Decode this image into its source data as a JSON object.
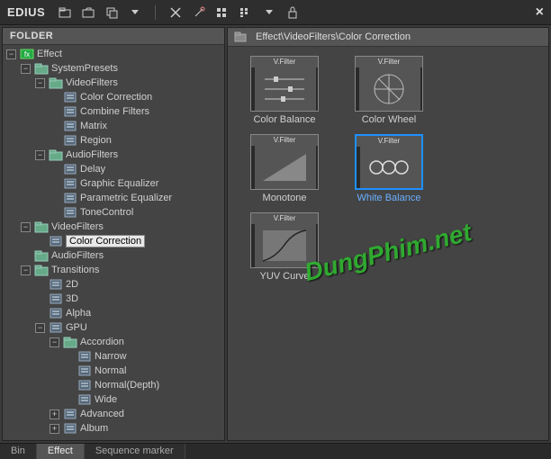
{
  "app": {
    "name": "EDIUS"
  },
  "titlebar_icons": [
    "folder",
    "tab",
    "copy",
    "dropdown",
    "cut",
    "wand",
    "list1",
    "list2",
    "lock"
  ],
  "left": {
    "header": "FOLDER",
    "tree": [
      {
        "d": 0,
        "exp": "-",
        "ico": "fx",
        "label": "Effect",
        "sel": false
      },
      {
        "d": 1,
        "exp": "-",
        "ico": "folder",
        "label": "SystemPresets"
      },
      {
        "d": 2,
        "exp": "-",
        "ico": "folder",
        "label": "VideoFilters"
      },
      {
        "d": 3,
        "exp": "",
        "ico": "fx-item",
        "label": "Color Correction"
      },
      {
        "d": 3,
        "exp": "",
        "ico": "fx-item",
        "label": "Combine Filters"
      },
      {
        "d": 3,
        "exp": "",
        "ico": "fx-item",
        "label": "Matrix"
      },
      {
        "d": 3,
        "exp": "",
        "ico": "fx-item",
        "label": "Region"
      },
      {
        "d": 2,
        "exp": "-",
        "ico": "folder",
        "label": "AudioFilters"
      },
      {
        "d": 3,
        "exp": "",
        "ico": "fx-item",
        "label": "Delay"
      },
      {
        "d": 3,
        "exp": "",
        "ico": "fx-item",
        "label": "Graphic Equalizer"
      },
      {
        "d": 3,
        "exp": "",
        "ico": "fx-item",
        "label": "Parametric Equalizer"
      },
      {
        "d": 3,
        "exp": "",
        "ico": "fx-item",
        "label": "ToneControl"
      },
      {
        "d": 1,
        "exp": "-",
        "ico": "folder",
        "label": "VideoFilters"
      },
      {
        "d": 2,
        "exp": "",
        "ico": "fx-item",
        "label": "Color Correction",
        "sel": true
      },
      {
        "d": 1,
        "exp": "",
        "ico": "folder",
        "label": "AudioFilters"
      },
      {
        "d": 1,
        "exp": "-",
        "ico": "folder",
        "label": "Transitions"
      },
      {
        "d": 2,
        "exp": "",
        "ico": "fx-item",
        "label": "2D"
      },
      {
        "d": 2,
        "exp": "",
        "ico": "fx-item",
        "label": "3D"
      },
      {
        "d": 2,
        "exp": "",
        "ico": "fx-item",
        "label": "Alpha"
      },
      {
        "d": 2,
        "exp": "-",
        "ico": "fx-item",
        "label": "GPU"
      },
      {
        "d": 3,
        "exp": "-",
        "ico": "folder",
        "label": "Accordion"
      },
      {
        "d": 4,
        "exp": "",
        "ico": "fx-item",
        "label": "Narrow"
      },
      {
        "d": 4,
        "exp": "",
        "ico": "fx-item",
        "label": "Normal"
      },
      {
        "d": 4,
        "exp": "",
        "ico": "fx-item",
        "label": "Normal(Depth)"
      },
      {
        "d": 4,
        "exp": "",
        "ico": "fx-item",
        "label": "Wide"
      },
      {
        "d": 3,
        "exp": "+",
        "ico": "fx-item",
        "label": "Advanced"
      },
      {
        "d": 3,
        "exp": "+",
        "ico": "fx-item",
        "label": "Album"
      }
    ]
  },
  "right": {
    "path": "Effect\\VideoFilters\\Color Correction",
    "thumb_header": "V.Filter",
    "items": [
      {
        "label": "Color Balance",
        "type": "sliders",
        "selected": false
      },
      {
        "label": "Color Wheel",
        "type": "wheel",
        "selected": false
      },
      {
        "label": "Monotone",
        "type": "mono",
        "selected": false
      },
      {
        "label": "White Balance",
        "type": "balls",
        "selected": true
      },
      {
        "label": "YUV Curve",
        "type": "curve",
        "selected": false
      }
    ]
  },
  "tabs": [
    {
      "label": "Bin",
      "active": false
    },
    {
      "label": "Effect",
      "active": true
    },
    {
      "label": "Sequence marker",
      "active": false
    }
  ],
  "watermark": "DungPhim.net"
}
